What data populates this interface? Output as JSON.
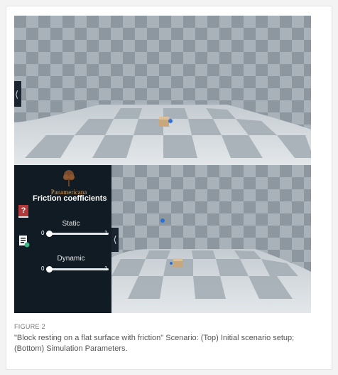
{
  "top_scene": {
    "name": "initial-scenario-view",
    "colors": {
      "tile_light": "#d8dde1",
      "tile_dark": "#97a1a8",
      "wall": "#a6afb6"
    }
  },
  "bottom_scene": {
    "name": "simulation-view"
  },
  "panel": {
    "logo_text": "Panamericana",
    "title": "Friction coefficients",
    "help_icon": "question-mark-icon",
    "doc_icon": "document-settings-icon",
    "sliders": [
      {
        "label": "Static",
        "min": "0",
        "max": "1",
        "value": 0
      },
      {
        "label": "Dynamic",
        "min": "0",
        "max": "1",
        "value": 0
      }
    ]
  },
  "figure": {
    "label": "FIGURE 2",
    "caption": "\"Block resting on a flat surface with friction\" Scenario: (Top) Initial scenario setup; (Bottom) Simulation Parameters."
  }
}
